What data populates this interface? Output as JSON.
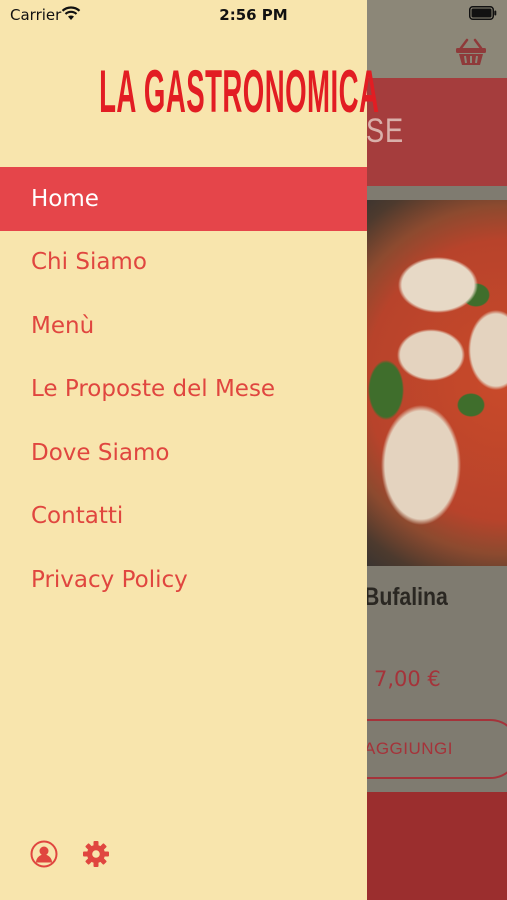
{
  "status_bar": {
    "carrier": "Carrier",
    "time": "2:56 PM"
  },
  "drawer": {
    "brand": "LA GASTRONOMICA",
    "nav_items": [
      {
        "label": "Home",
        "active": true
      },
      {
        "label": "Chi Siamo",
        "active": false
      },
      {
        "label": "Menù",
        "active": false
      },
      {
        "label": "Le Proposte del Mese",
        "active": false
      },
      {
        "label": "Dove Siamo",
        "active": false
      },
      {
        "label": "Contatti",
        "active": false
      },
      {
        "label": "Privacy Policy",
        "active": false
      }
    ],
    "footer_icons": [
      "user-icon",
      "gear-icon"
    ]
  },
  "background_app": {
    "title_fragment": "SE",
    "product_name_fragment": "Bufalina",
    "price": "7,00 €",
    "add_button_fragment": "AGGIUNGI",
    "cart_icon": "basket-icon"
  },
  "colors": {
    "drawer_bg": "#f8e5ad",
    "brand_red": "#e21d23",
    "nav_text": "#e0463f",
    "active_bg": "#e5454a"
  }
}
